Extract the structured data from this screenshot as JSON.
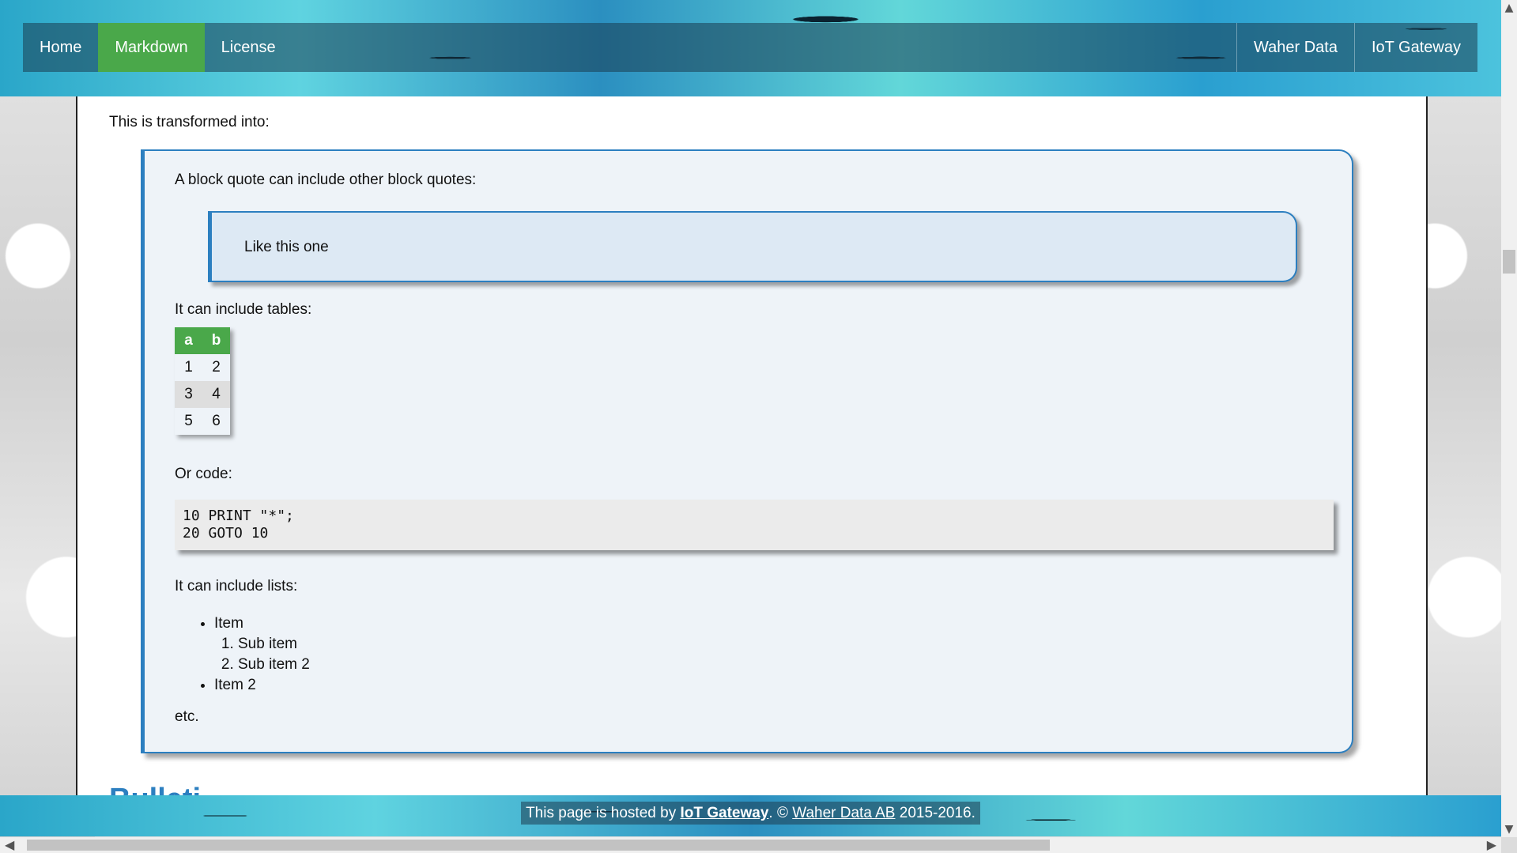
{
  "navbar": {
    "left": [
      "Home",
      "Markdown",
      "License"
    ],
    "right": [
      "Waher Data",
      "IoT Gateway"
    ],
    "active": "Markdown",
    "active_color": "#4aa84a"
  },
  "content": {
    "intro": "This is transformed into:",
    "blockquote": {
      "p1": "A block quote can include other block quotes:",
      "inner": "Like this one",
      "p2": "It can include tables:",
      "table": {
        "headers": [
          "a",
          "b"
        ],
        "rows": [
          [
            "1",
            "2"
          ],
          [
            "3",
            "4"
          ],
          [
            "5",
            "6"
          ]
        ]
      },
      "p3": "Or code:",
      "code_line1": "10 PRINT \"*\";",
      "code_line2": "20 GOTO 10",
      "p4": "It can include lists:",
      "list": {
        "item1": "Item",
        "sub1": "Sub item",
        "sub2": "Sub item 2",
        "item2": "Item 2"
      },
      "p5": "etc."
    },
    "next_heading_partial": "Bulleti"
  },
  "footer": {
    "prefix": "This page is hosted by ",
    "link1": "IoT Gateway",
    "middle": ". © ",
    "link2": "Waher Data AB",
    "suffix": " 2015-2016."
  }
}
